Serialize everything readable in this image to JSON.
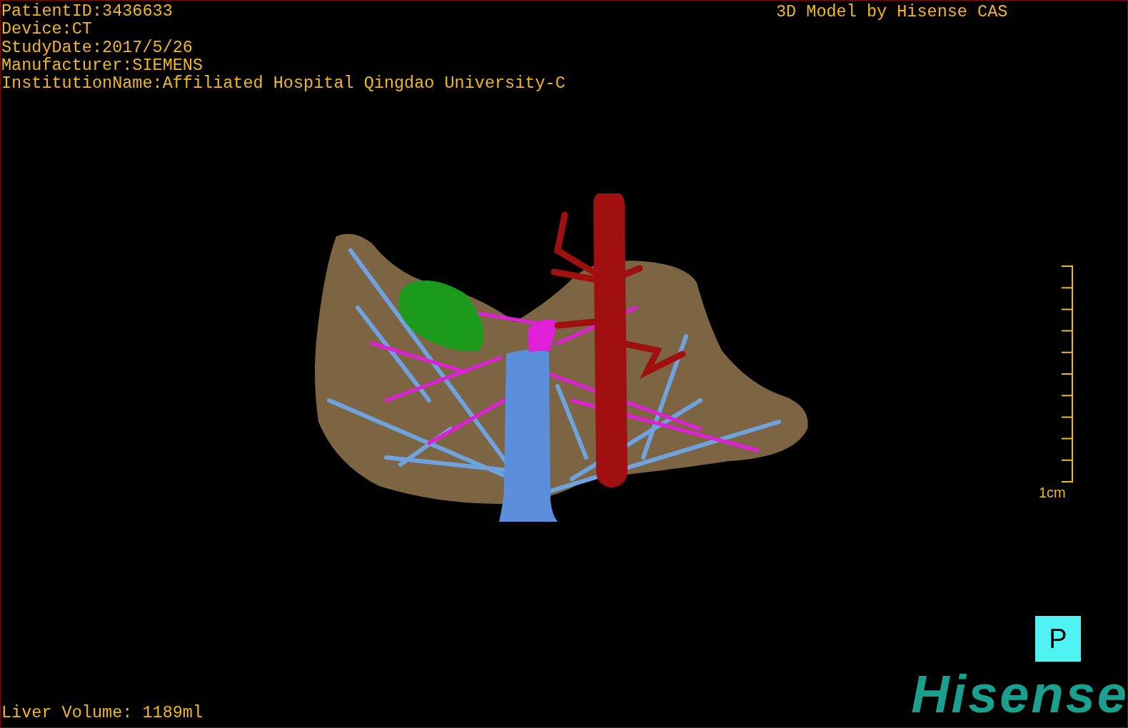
{
  "info_lines": [
    "PatientID:3436633",
    "Device:CT",
    "StudyDate:2017/5/26",
    "Manufacturer:SIEMENS",
    "InstitutionName:Affiliated Hospital Qingdao University-C"
  ],
  "title": "3D Model by Hisense CAS",
  "scale_bar": {
    "label": "1cm"
  },
  "view_button": {
    "label": "P"
  },
  "liver_volume": "Liver Volume: 1189ml",
  "logo": {
    "text": "Hisense"
  }
}
